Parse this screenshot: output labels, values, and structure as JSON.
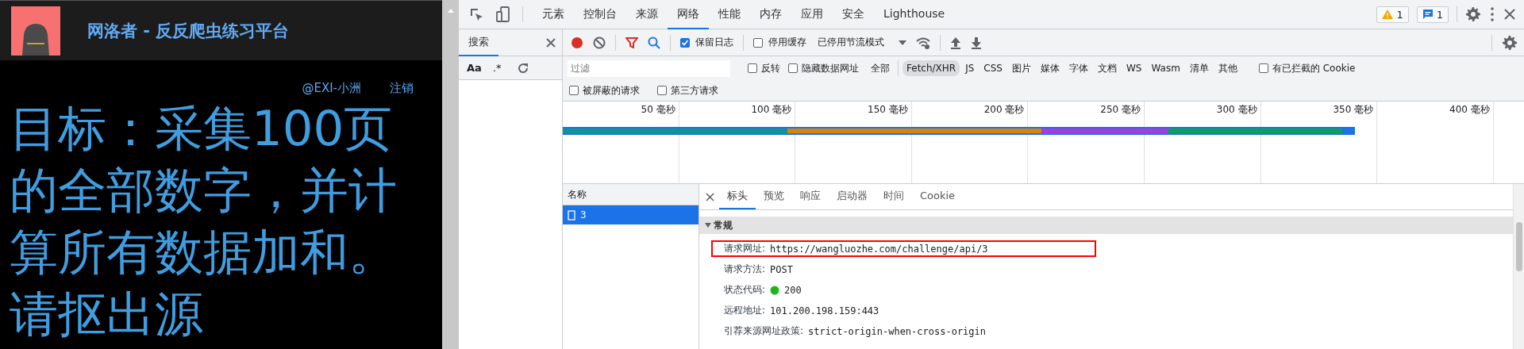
{
  "site": {
    "title": "网洛者 - 反反爬虫练习平台",
    "user": "@EXI-小洲",
    "logout": "注销",
    "goal": "目标：采集100页的全部数字，并计算所有数据加和。请抠出源"
  },
  "devtools": {
    "tabs": [
      {
        "label": "元素",
        "selected": false
      },
      {
        "label": "控制台",
        "selected": false
      },
      {
        "label": "来源",
        "selected": false
      },
      {
        "label": "网络",
        "selected": true
      },
      {
        "label": "性能",
        "selected": false
      },
      {
        "label": "内存",
        "selected": false
      },
      {
        "label": "应用",
        "selected": false
      },
      {
        "label": "安全",
        "selected": false
      },
      {
        "label": "Lighthouse",
        "selected": false
      }
    ],
    "warnings": "1",
    "messages": "1",
    "search_panel": {
      "tab": {
        "label": "搜索",
        "selected": true
      },
      "case_option": "Aa",
      "regex_option": ".*"
    },
    "toolbar": {
      "recording": true,
      "preserve_log": {
        "label": "保留日志",
        "checked": true
      },
      "disable_cache": {
        "label": "停用缓存",
        "checked": false
      },
      "throttling": "已停用节流模式"
    },
    "filter": {
      "placeholder": "过滤",
      "invert": {
        "label": "反转",
        "checked": false
      },
      "hide_data_urls": {
        "label": "隐藏数据网址",
        "checked": false
      },
      "types": [
        {
          "label": "全部",
          "selected": false
        },
        {
          "label": "Fetch/XHR",
          "selected": true
        },
        {
          "label": "JS",
          "selected": false
        },
        {
          "label": "CSS",
          "selected": false
        },
        {
          "label": "图片",
          "selected": false
        },
        {
          "label": "媒体",
          "selected": false
        },
        {
          "label": "字体",
          "selected": false
        },
        {
          "label": "文档",
          "selected": false
        },
        {
          "label": "WS",
          "selected": false
        },
        {
          "label": "Wasm",
          "selected": false
        },
        {
          "label": "清单",
          "selected": false
        },
        {
          "label": "其他",
          "selected": false
        }
      ],
      "blocked_cookies": {
        "label": "有已拦截的 Cookie",
        "checked": false
      },
      "blocked_requests": {
        "label": "被屏蔽的请求",
        "checked": false
      },
      "third_party": {
        "label": "第三方请求",
        "checked": false
      }
    },
    "timeline": {
      "ticks": [
        "50 毫秒",
        "100 毫秒",
        "150 毫秒",
        "200 毫秒",
        "250 毫秒",
        "300 毫秒",
        "350 毫秒",
        "400 毫秒"
      ]
    },
    "requests": {
      "header": "名称",
      "rows": [
        {
          "name": "3",
          "selected": true
        }
      ]
    },
    "detail": {
      "tabs": [
        {
          "label": "标头",
          "selected": true
        },
        {
          "label": "预览",
          "selected": false
        },
        {
          "label": "响应",
          "selected": false
        },
        {
          "label": "启动器",
          "selected": false
        },
        {
          "label": "时间",
          "selected": false
        },
        {
          "label": "Cookie",
          "selected": false
        }
      ],
      "section": {
        "title": "常规",
        "expanded": true
      },
      "fields": [
        {
          "kind": "text",
          "label": "请求网址:",
          "value": "https://wangluozhe.com/challenge/api/3",
          "highlighted": true
        },
        {
          "kind": "text",
          "label": "请求方法:",
          "value": "POST",
          "highlighted": false
        },
        {
          "kind": "status",
          "label": "状态代码:",
          "value": "200",
          "color": "#1fb324",
          "highlighted": false
        },
        {
          "kind": "text",
          "label": "远程地址:",
          "value": "101.200.198.159:443",
          "highlighted": false
        },
        {
          "kind": "text",
          "label": "引荐来源网址政策:",
          "value": "strict-origin-when-cross-origin",
          "highlighted": false
        }
      ]
    }
  }
}
